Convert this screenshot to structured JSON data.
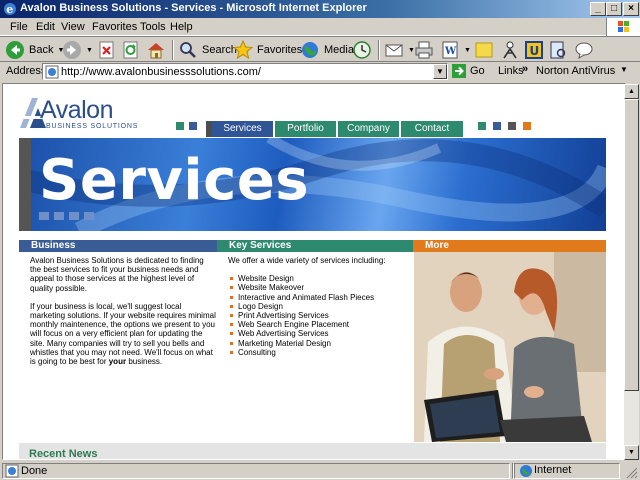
{
  "window": {
    "title": "Avalon Business Solutions - Services - Microsoft Internet Explorer",
    "controls": {
      "minimize": "_",
      "maximize": "□",
      "close": "×"
    }
  },
  "menu": [
    "File",
    "Edit",
    "View",
    "Favorites",
    "Tools",
    "Help"
  ],
  "toolbar": {
    "back": "Back",
    "search": "Search",
    "favorites": "Favorites",
    "media": "Media"
  },
  "address": {
    "label": "Address",
    "url": "http://www.avalonbusinesssolutions.com/",
    "go": "Go",
    "links": "Links",
    "chevron": "»",
    "norton": "Norton AntiVirus"
  },
  "site": {
    "logo": {
      "word": "Avalon",
      "sub": "BUSINESS SOLUTIONS"
    },
    "nav": [
      "Services",
      "Portfolio",
      "Company",
      "Contact"
    ],
    "banner_title": "Services",
    "columns": {
      "business": {
        "heading": "Business",
        "paragraphs": [
          "Avalon Business Solutions is dedicated to finding the best services to fit your business needs and appeal to those services at the highest level of quality possible.",
          "If your business is local, we'll suggest local marketing solutions. If your website requires minimal monthly maintenence, the options we present to you will focus on a very efficient plan for updating the site. Many companies will try to sell you bells and whistles that you may not need. We'll focus on what is going to be best for",
          "your",
          "business."
        ]
      },
      "key_services": {
        "heading": "Key Services",
        "intro": "We offer a wide variety of services including:",
        "items": [
          "Website Design",
          "Website Makeover",
          "Interactive and Animated Flash Pieces",
          "Logo Design",
          "Print Advertising Services",
          "Web Search Engine Placement",
          "Web Advertising Services",
          "Marketing Material Design",
          "Consulting"
        ]
      },
      "more": {
        "heading": "More"
      }
    },
    "news_title": "Recent News"
  },
  "status": {
    "text": "Done",
    "zone": "Internet"
  },
  "colors": {
    "business_head": "#3a5c96",
    "key_services_head": "#2e8a6e",
    "more_head": "#e07a1a",
    "nav_active": "#2f5597",
    "nav_tab": "#2e8a6e",
    "brand": "#2b4f8a"
  }
}
